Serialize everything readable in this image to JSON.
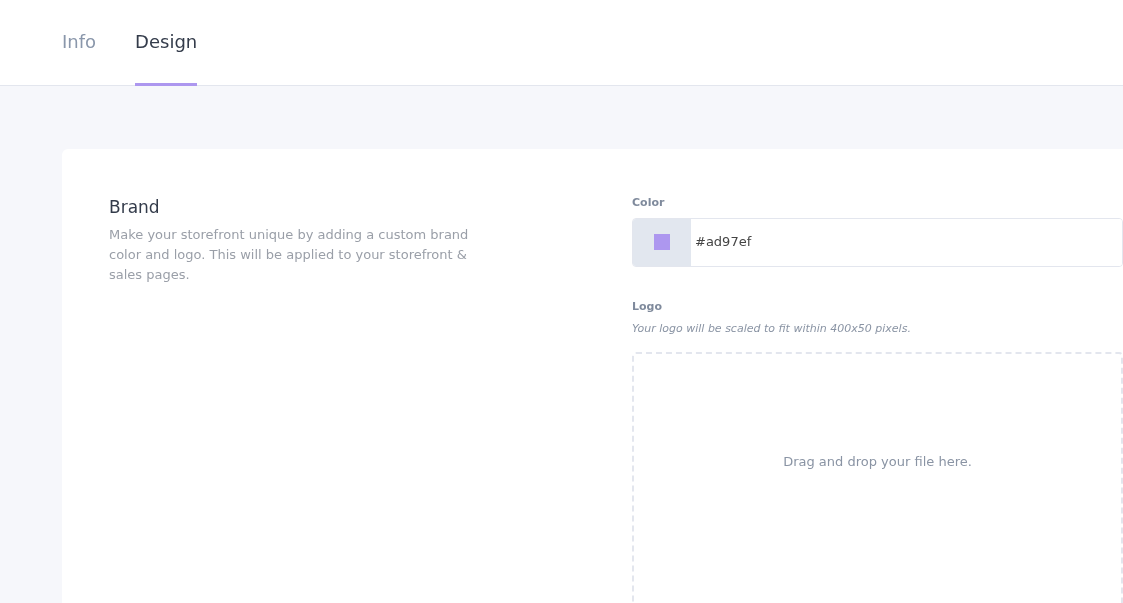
{
  "tabs": [
    {
      "label": "Info",
      "selected": false
    },
    {
      "label": "Design",
      "selected": true
    }
  ],
  "brand": {
    "title": "Brand",
    "description": "Make your storefront unique by adding a custom brand color and logo. This will be applied to your storefront & sales pages."
  },
  "color": {
    "label": "Color",
    "value": "#ad97ef"
  },
  "logo": {
    "label": "Logo",
    "hint": "Your logo will be scaled to fit within 400x50 pixels.",
    "dropzone_text": "Drag and drop your file here."
  }
}
